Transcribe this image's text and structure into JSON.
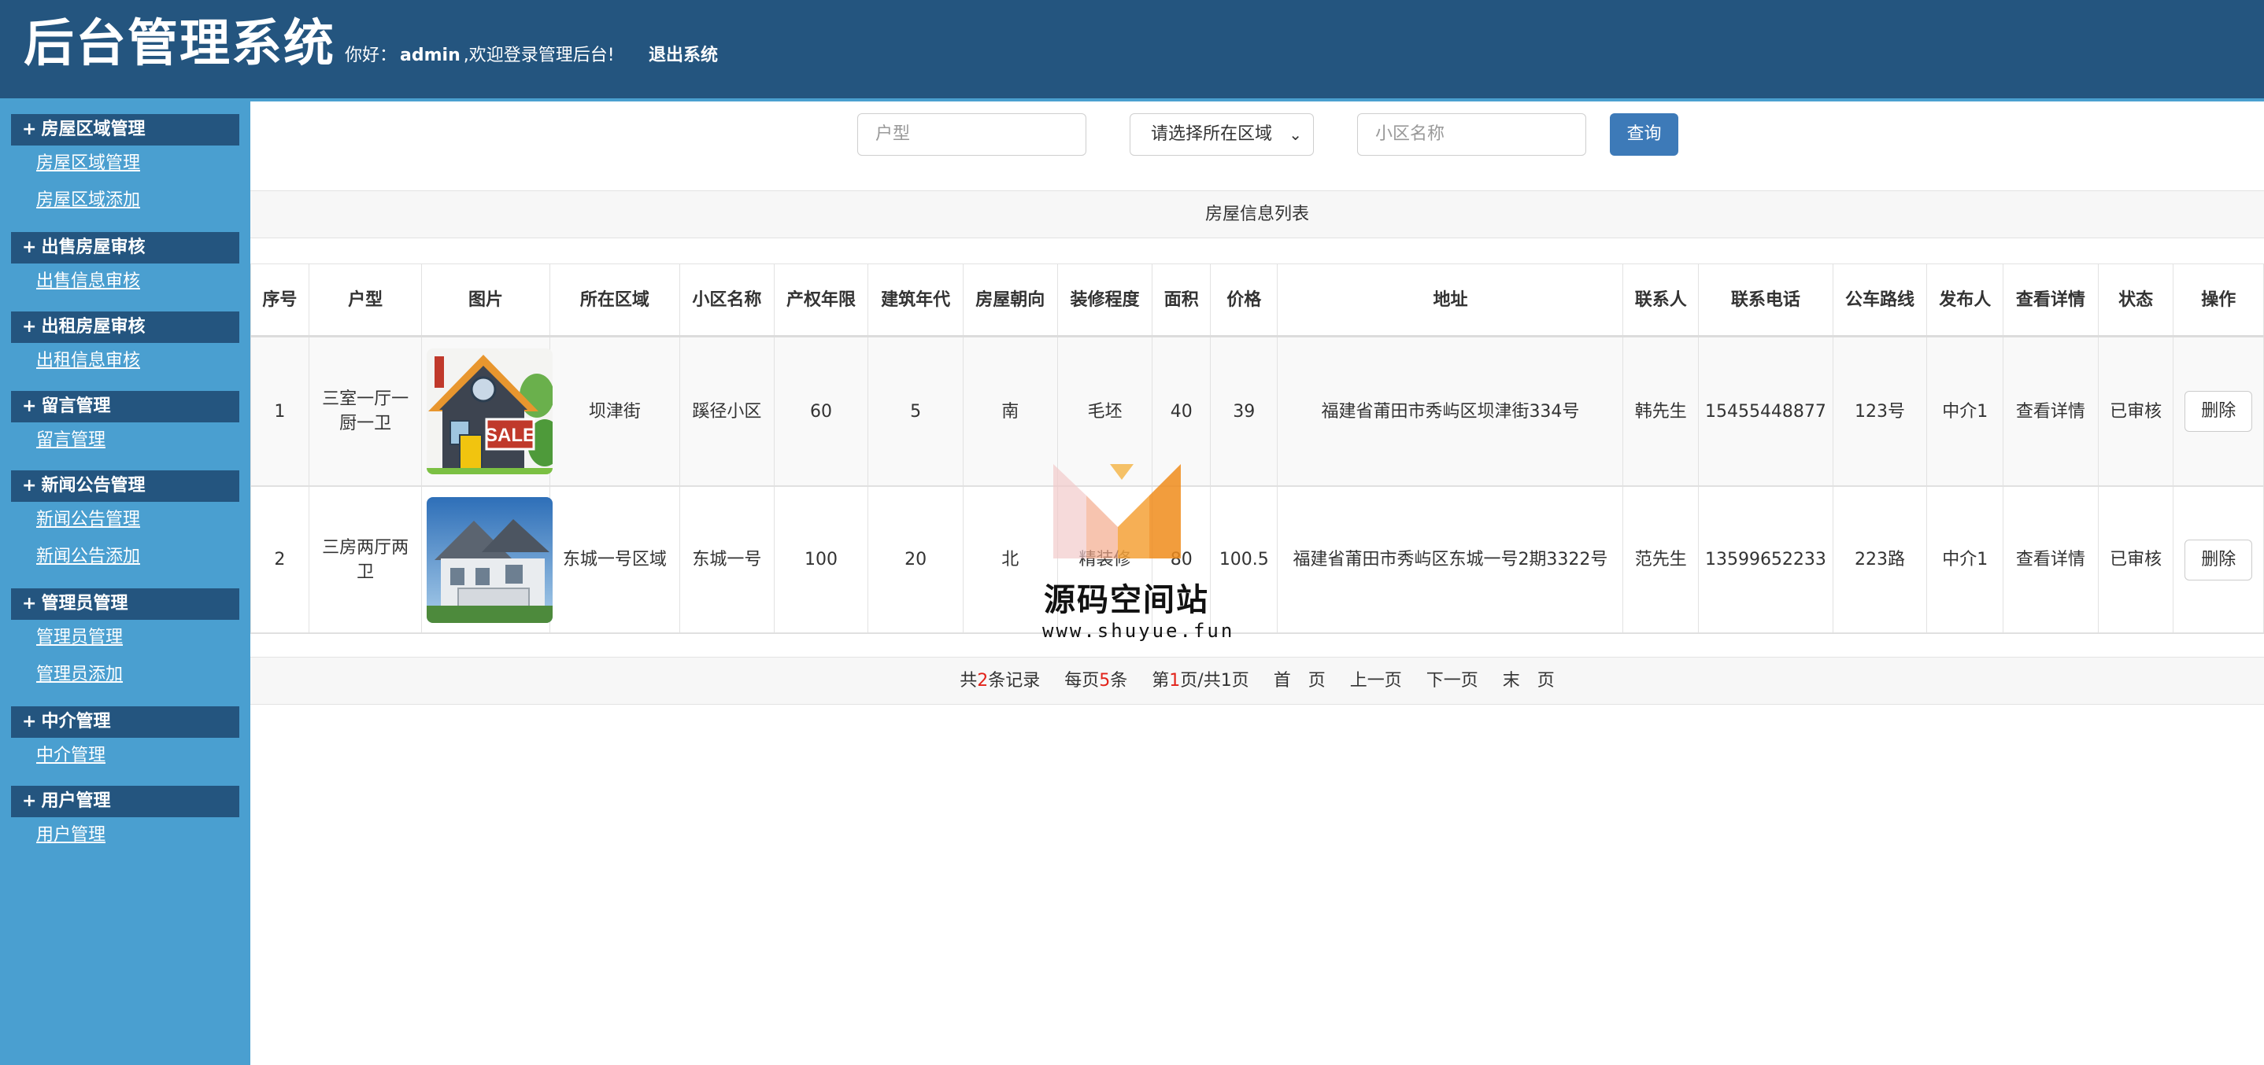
{
  "header": {
    "title": "后台管理系统",
    "greeting_prefix": "你好：",
    "username": "admin",
    "greeting_suffix": ",欢迎登录管理后台!",
    "logout": "退出系统"
  },
  "sidebar": {
    "groups": [
      {
        "title": "房屋区域管理",
        "links": [
          "房屋区域管理",
          "房屋区域添加"
        ]
      },
      {
        "title": "出售房屋审核",
        "links": [
          "出售信息审核"
        ]
      },
      {
        "title": "出租房屋审核",
        "links": [
          "出租信息审核"
        ]
      },
      {
        "title": "留言管理",
        "links": [
          "留言管理"
        ]
      },
      {
        "title": "新闻公告管理",
        "links": [
          "新闻公告管理",
          "新闻公告添加"
        ]
      },
      {
        "title": "管理员管理",
        "links": [
          "管理员管理",
          "管理员添加"
        ]
      },
      {
        "title": "中介管理",
        "links": [
          "中介管理"
        ]
      },
      {
        "title": "用户管理",
        "links": [
          "用户管理"
        ]
      }
    ]
  },
  "search": {
    "layout_placeholder": "户型",
    "region_select": "请选择所在区域",
    "community_placeholder": "小区名称",
    "query_button": "查询"
  },
  "table": {
    "caption": "房屋信息列表",
    "headers": [
      "序号",
      "户型",
      "图片",
      "所在区域",
      "小区名称",
      "产权年限",
      "建筑年代",
      "房屋朝向",
      "装修程度",
      "面积",
      "价格",
      "地址",
      "联系人",
      "联系电话",
      "公车路线",
      "发布人",
      "查看详情",
      "状态",
      "操作"
    ],
    "rows": [
      {
        "no": "1",
        "layout": "三室一厅一厨一卫",
        "region": "坝津街",
        "community": "蹊径小区",
        "years": "60",
        "built": "5",
        "facing": "南",
        "decor": "毛坯",
        "area": "40",
        "price": "39",
        "address": "福建省莆田市秀屿区坝津街334号",
        "contact": "韩先生",
        "phone": "15455448877",
        "bus": "123号",
        "publisher": "中介1",
        "detail": "查看详情",
        "status": "已审核",
        "action": "删除"
      },
      {
        "no": "2",
        "layout": "三房两厅两卫",
        "region": "东城一号区域",
        "community": "东城一号",
        "years": "100",
        "built": "20",
        "facing": "北",
        "decor": "精装修",
        "area": "80",
        "price": "100.5",
        "address": "福建省莆田市秀屿区东城一号2期3322号",
        "contact": "范先生",
        "phone": "13599652233",
        "bus": "223路",
        "publisher": "中介1",
        "detail": "查看详情",
        "status": "已审核",
        "action": "删除"
      }
    ]
  },
  "pager": {
    "total_prefix": "共",
    "total": "2",
    "total_suffix": "条记录",
    "per_prefix": "每页",
    "per": "5",
    "per_suffix": "条",
    "page_prefix": "第",
    "page": "1",
    "page_suffix": "页/共1页",
    "first": "首　页",
    "prev": "上一页",
    "next": "下一页",
    "last": "末　页"
  },
  "watermark": {
    "name": "源码空间站",
    "url": "www.shuyue.fun"
  },
  "colors": {
    "header_bg": "#24557f",
    "sidebar_bg": "#4a9fd0",
    "button_bg": "#3d7ab8",
    "accent_red": "#e2231a"
  }
}
